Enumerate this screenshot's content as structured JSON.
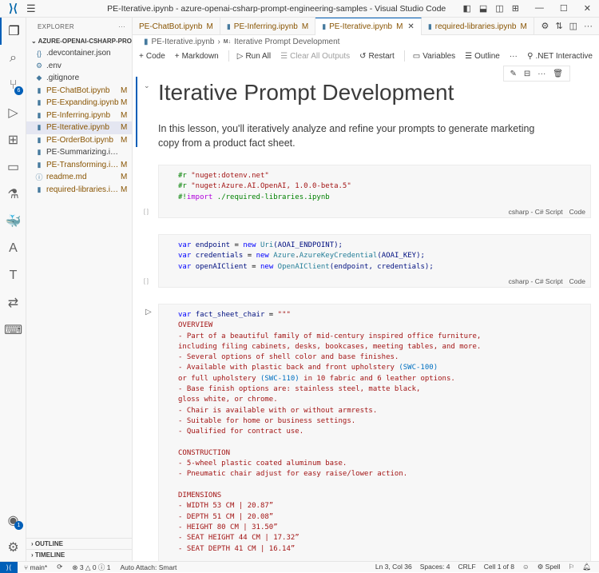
{
  "window": {
    "title": "PE-Iterative.ipynb - azure-openai-csharp-prompt-engineering-samples - Visual Studio Code"
  },
  "activity": {
    "scm_badge": "6",
    "accounts_badge": "1"
  },
  "explorer": {
    "header": "EXPLORER",
    "root": "AZURE-OPENAI-CSHARP-PRO...",
    "files": [
      {
        "name": ".devcontainer.json",
        "icon": "braces-icon",
        "status": ""
      },
      {
        "name": ".env",
        "icon": "gear-icon",
        "status": ""
      },
      {
        "name": ".gitignore",
        "icon": "git-icon",
        "status": ""
      },
      {
        "name": "PE-ChatBot.ipynb",
        "icon": "notebook-icon",
        "status": "M"
      },
      {
        "name": "PE-Expanding.ipynb",
        "icon": "notebook-icon",
        "status": "M"
      },
      {
        "name": "PE-Inferring.ipynb",
        "icon": "notebook-icon",
        "status": "M"
      },
      {
        "name": "PE-Iterative.ipynb",
        "icon": "notebook-icon",
        "status": "M"
      },
      {
        "name": "PE-OrderBot.ipynb",
        "icon": "notebook-icon",
        "status": "M"
      },
      {
        "name": "PE-Summarizing.ipynb",
        "icon": "notebook-icon",
        "status": ""
      },
      {
        "name": "PE-Transforming.ip...",
        "icon": "notebook-icon",
        "status": "M"
      },
      {
        "name": "readme.md",
        "icon": "info-icon",
        "status": "M"
      },
      {
        "name": "required-libraries.ip...",
        "icon": "notebook-icon",
        "status": "M"
      }
    ],
    "outline": "OUTLINE",
    "timeline": "TIMELINE"
  },
  "tabs": [
    {
      "label": "PE-ChatBot.ipynb",
      "status": "M"
    },
    {
      "label": "PE-Inferring.ipynb",
      "status": "M"
    },
    {
      "label": "PE-Iterative.ipynb",
      "status": "M"
    },
    {
      "label": "required-libraries.ipynb",
      "status": "M"
    }
  ],
  "breadcrumb": {
    "file": "PE-Iterative.ipynb",
    "section": "Iterative Prompt Development"
  },
  "toolbar": {
    "code": "Code",
    "markdown": "Markdown",
    "run_all": "Run All",
    "clear": "Clear All Outputs",
    "restart": "Restart",
    "variables": "Variables",
    "outline": "Outline",
    "kernel": ".NET Interactive"
  },
  "notebook": {
    "heading": "Iterative Prompt Development",
    "intro": "In this lesson, you'll iteratively analyze and refine your prompts to generate marketing copy from a product fact sheet.",
    "cell_lang": "csharp - C# Script",
    "cell_type": "Code",
    "exec_empty": "[ ]",
    "cells": [
      [
        [
          [
            "#r ",
            "dir"
          ],
          [
            "\"nuget:dotenv.net\"",
            "str"
          ]
        ],
        [
          [
            "#r ",
            "dir"
          ],
          [
            "\"nuget:Azure.AI.OpenAI, 1.0.0-beta.5\"",
            "str"
          ]
        ],
        [
          [
            "#!",
            "dir"
          ],
          [
            "import",
            "imp"
          ],
          [
            " ./required-libraries.ipynb",
            "dir"
          ]
        ]
      ],
      [
        [
          [
            "var ",
            "kw"
          ],
          [
            "endpoint",
            "id"
          ],
          [
            " = ",
            "pl"
          ],
          [
            "new ",
            "kw"
          ],
          [
            "Uri",
            "cls"
          ],
          [
            "(AOAI_ENDPOINT);",
            "id"
          ]
        ],
        [
          [
            "var ",
            "kw"
          ],
          [
            "credentials",
            "id"
          ],
          [
            " = ",
            "pl"
          ],
          [
            "new ",
            "kw"
          ],
          [
            "Azure",
            "cls"
          ],
          [
            ".",
            "pl"
          ],
          [
            "AzureKeyCredential",
            "cls"
          ],
          [
            "(AOAI_KEY);",
            "id"
          ]
        ],
        [
          [
            "var ",
            "kw"
          ],
          [
            "openAIClient",
            "id"
          ],
          [
            " = ",
            "pl"
          ],
          [
            "new ",
            "kw"
          ],
          [
            "OpenAIClient",
            "cls"
          ],
          [
            "(endpoint, credentials);",
            "id"
          ]
        ]
      ],
      [
        [
          [
            "var ",
            "kw"
          ],
          [
            "fact_sheet_chair",
            "id"
          ],
          [
            " = ",
            "pl"
          ],
          [
            "\"\"\"",
            "str"
          ]
        ],
        [
          [
            "OVERVIEW",
            "str"
          ]
        ],
        [
          [
            "- Part of a beautiful family of mid-century inspired office furniture,",
            "str"
          ]
        ],
        [
          [
            "including filing cabinets, desks, bookcases, meeting tables, and more.",
            "str"
          ]
        ],
        [
          [
            "- Several options of shell color and base finishes.",
            "str"
          ]
        ],
        [
          [
            "- Available with plastic back and front upholstery ",
            "str"
          ],
          [
            "(SWC-100)",
            "esc"
          ]
        ],
        [
          [
            "or full upholstery ",
            "str"
          ],
          [
            "(SWC-110)",
            "esc"
          ],
          [
            " in 10 fabric and 6 leather options.",
            "str"
          ]
        ],
        [
          [
            "- Base finish options are: stainless steel, matte black,",
            "str"
          ]
        ],
        [
          [
            "gloss white, or chrome.",
            "str"
          ]
        ],
        [
          [
            "- Chair is available with or without armrests.",
            "str"
          ]
        ],
        [
          [
            "- Suitable for home or business settings.",
            "str"
          ]
        ],
        [
          [
            "- Qualified for contract use.",
            "str"
          ]
        ],
        [
          [
            "",
            "str"
          ]
        ],
        [
          [
            "CONSTRUCTION",
            "str"
          ]
        ],
        [
          [
            "- 5-wheel plastic coated aluminum base.",
            "str"
          ]
        ],
        [
          [
            "- Pneumatic chair adjust for easy raise/lower action.",
            "str"
          ]
        ],
        [
          [
            "",
            "str"
          ]
        ],
        [
          [
            "DIMENSIONS",
            "str"
          ]
        ],
        [
          [
            "- WIDTH 53 CM | 20.87”",
            "str"
          ]
        ],
        [
          [
            "- DEPTH 51 CM | 20.08”",
            "str"
          ]
        ],
        [
          [
            "- HEIGHT 80 CM | 31.50”",
            "str"
          ]
        ],
        [
          [
            "- SEAT HEIGHT 44 CM | 17.32”",
            "str"
          ]
        ],
        [
          [
            "- SEAT DEPTH 41 CM | 16.14”",
            "str"
          ]
        ]
      ]
    ]
  },
  "status": {
    "branch": "main*",
    "errors": "3",
    "warnings": "0",
    "info": "1",
    "auto_attach": "Auto Attach: Smart",
    "position": "Ln 3, Col 36",
    "spaces": "Spaces: 4",
    "eol": "CRLF",
    "cell": "Cell 1 of 8",
    "spell": "Spell"
  },
  "colors": {
    "accent": "#005fb8",
    "modified": "#895503",
    "string": "#a31515",
    "keyword": "#0000ff"
  }
}
